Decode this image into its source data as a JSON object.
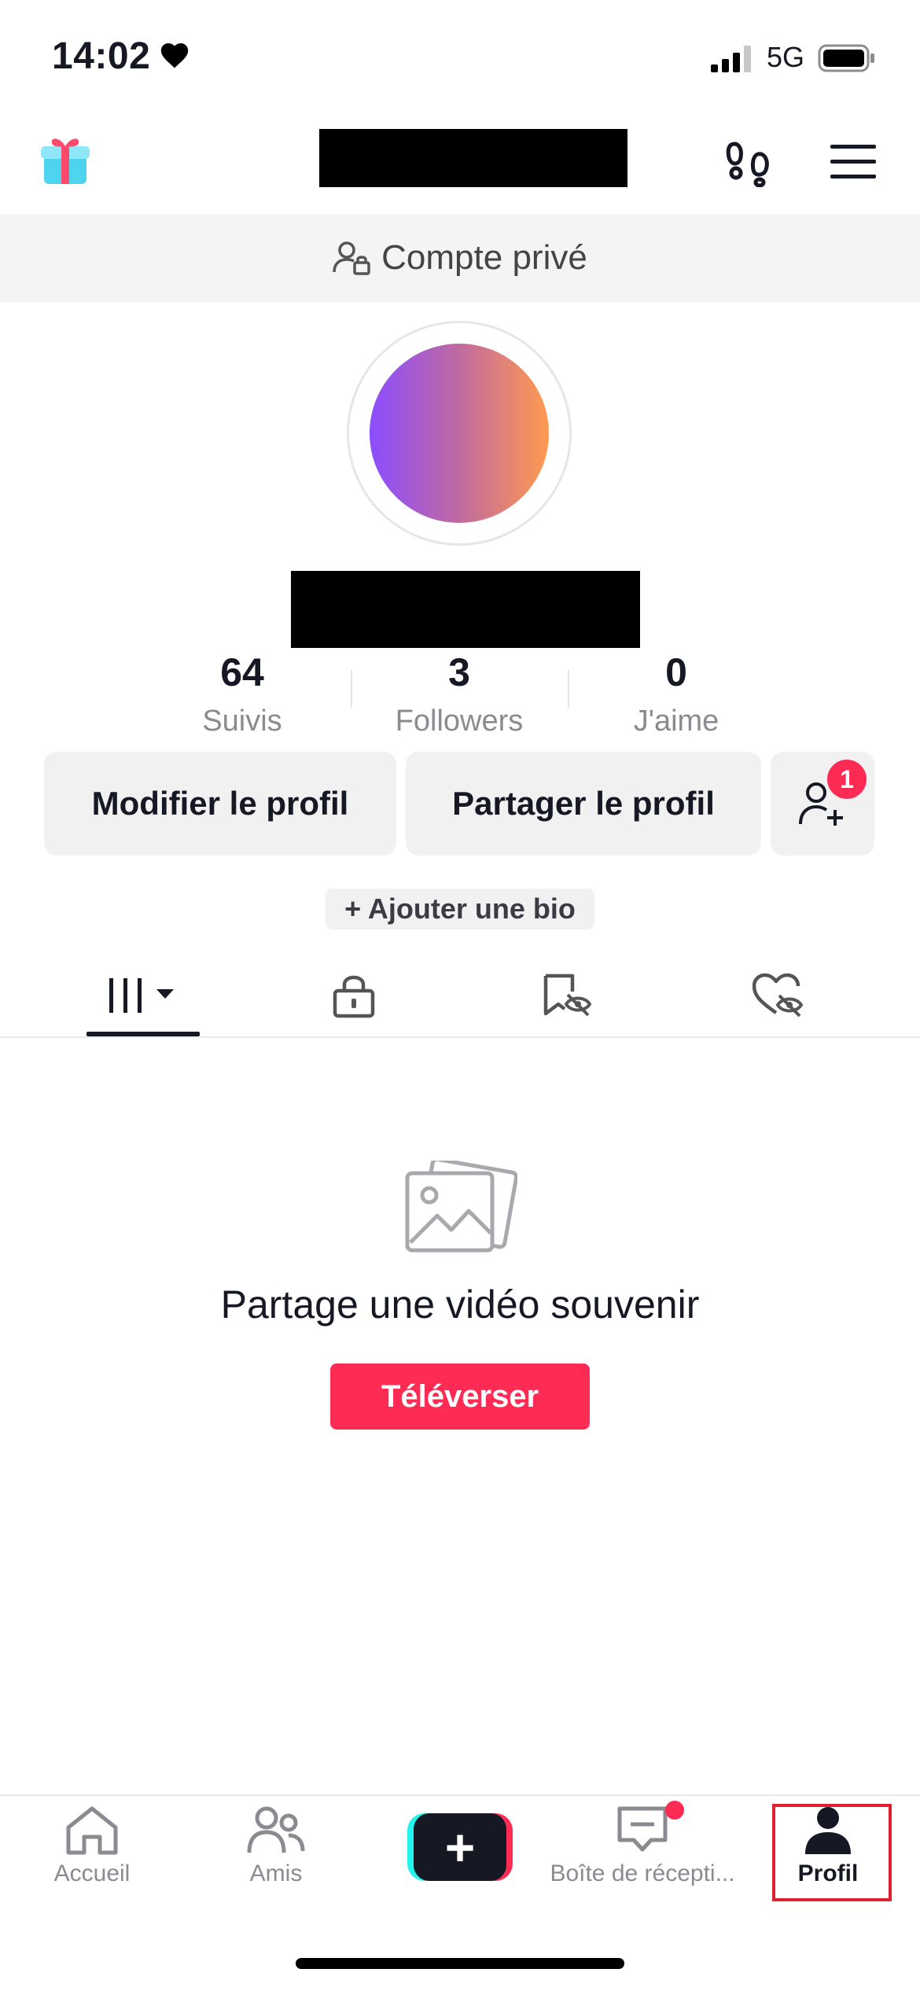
{
  "status_bar": {
    "time": "14:02",
    "network": "5G",
    "icons": [
      "heart-icon",
      "signal-icon",
      "battery-icon"
    ]
  },
  "header": {
    "gift_icon": "gift-icon",
    "footprint_icon": "footprint-icon",
    "menu_icon": "hamburger-menu-icon"
  },
  "privacy_banner": {
    "label": "Compte privé",
    "icon": "private-account-icon"
  },
  "profile": {
    "stats": [
      {
        "value": "64",
        "label": "Suivis"
      },
      {
        "value": "3",
        "label": "Followers"
      },
      {
        "value": "0",
        "label": "J'aime"
      }
    ],
    "buttons": {
      "edit": "Modifier le profil",
      "share": "Partager le profil",
      "add_friend_badge": "1"
    },
    "bio_chip": "+ Ajouter une bio"
  },
  "tabs": [
    {
      "icon": "videos-grid-icon",
      "active": true
    },
    {
      "icon": "lock-icon",
      "active": false
    },
    {
      "icon": "hidden-bookmark-icon",
      "active": false
    },
    {
      "icon": "hidden-likes-icon",
      "active": false
    }
  ],
  "empty_state": {
    "title": "Partage une vidéo souvenir",
    "button": "Téléverser"
  },
  "bottom_nav": {
    "items": [
      {
        "label": "Accueil",
        "icon": "home-icon"
      },
      {
        "label": "Amis",
        "icon": "friends-icon"
      },
      {
        "label": "",
        "icon": "create-plus-icon"
      },
      {
        "label": "Boîte de récepti...",
        "icon": "inbox-icon"
      },
      {
        "label": "Profil",
        "icon": "profile-icon",
        "active": true
      }
    ]
  },
  "colors": {
    "accent": "#fe2c55",
    "text_primary": "#161823",
    "text_secondary": "#8a8b91",
    "button_bg": "#f1f1f2",
    "banner_bg": "#f4f4f4"
  }
}
